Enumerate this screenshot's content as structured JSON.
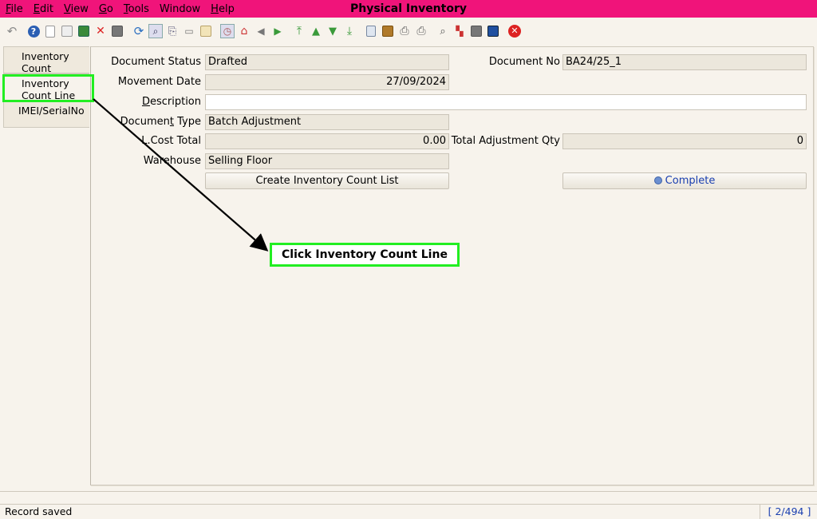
{
  "window": {
    "title": "Physical Inventory"
  },
  "menu": [
    {
      "pre": "",
      "u": "F",
      "post": "ile"
    },
    {
      "pre": "",
      "u": "E",
      "post": "dit"
    },
    {
      "pre": "",
      "u": "V",
      "post": "iew"
    },
    {
      "pre": "",
      "u": "G",
      "post": "o"
    },
    {
      "pre": "",
      "u": "T",
      "post": "ools"
    },
    {
      "pre": "Windo",
      "u": "",
      "post": "w"
    },
    {
      "pre": "",
      "u": "H",
      "post": "elp"
    }
  ],
  "toolbar": {
    "icons": [
      "undo-icon",
      "help-icon",
      "new-icon",
      "copy-icon",
      "save-new-icon",
      "delete-icon",
      "save-icon",
      "refresh-icon",
      "find-icon",
      "attachment-icon",
      "chat-icon",
      "history-icon",
      "home-icon",
      "parent-icon",
      "back-icon",
      "forward-icon",
      "first-icon",
      "previous-icon",
      "next-icon",
      "last-icon",
      "report-icon",
      "archive-icon",
      "print-preview-icon",
      "print-icon",
      "zoom-across-icon",
      "workflow-icon",
      "requests-icon",
      "product-info-icon",
      "close-icon"
    ]
  },
  "tabs": {
    "inventory_count": "Inventory Count",
    "inventory_count_line": "Inventory Count Line",
    "imei": "IMEI/SerialNo"
  },
  "form": {
    "document_status_label": "Document Status",
    "document_status_value": "Drafted",
    "document_no_label": "Document No",
    "document_no_value": "BA24/25_1",
    "movement_date_label": "Movement Date",
    "movement_date_value": "27/09/2024",
    "description_label_u": "D",
    "description_label_rest": "escription",
    "description_value": "",
    "document_type_label_pre": "Documen",
    "document_type_label_u": "t",
    "document_type_label_post": " Type",
    "document_type_value": "Batch Adjustment",
    "cost_total_label": "L.Cost Total",
    "cost_total_value": "0.00",
    "total_adj_label": "Total Adjustment Qty",
    "total_adj_value": "0",
    "warehouse_label": "Warehouse",
    "warehouse_value": "Selling Floor",
    "create_list_button": "Create Inventory Count List",
    "complete_button": "Complete"
  },
  "callout": {
    "text": "Click Inventory Count Line"
  },
  "status": {
    "message": "Record saved",
    "record": "[ 2/494 ]"
  },
  "colors": {
    "titlebar": "#f0147a",
    "highlight": "#22ee22",
    "panel": "#f7f3ec"
  }
}
